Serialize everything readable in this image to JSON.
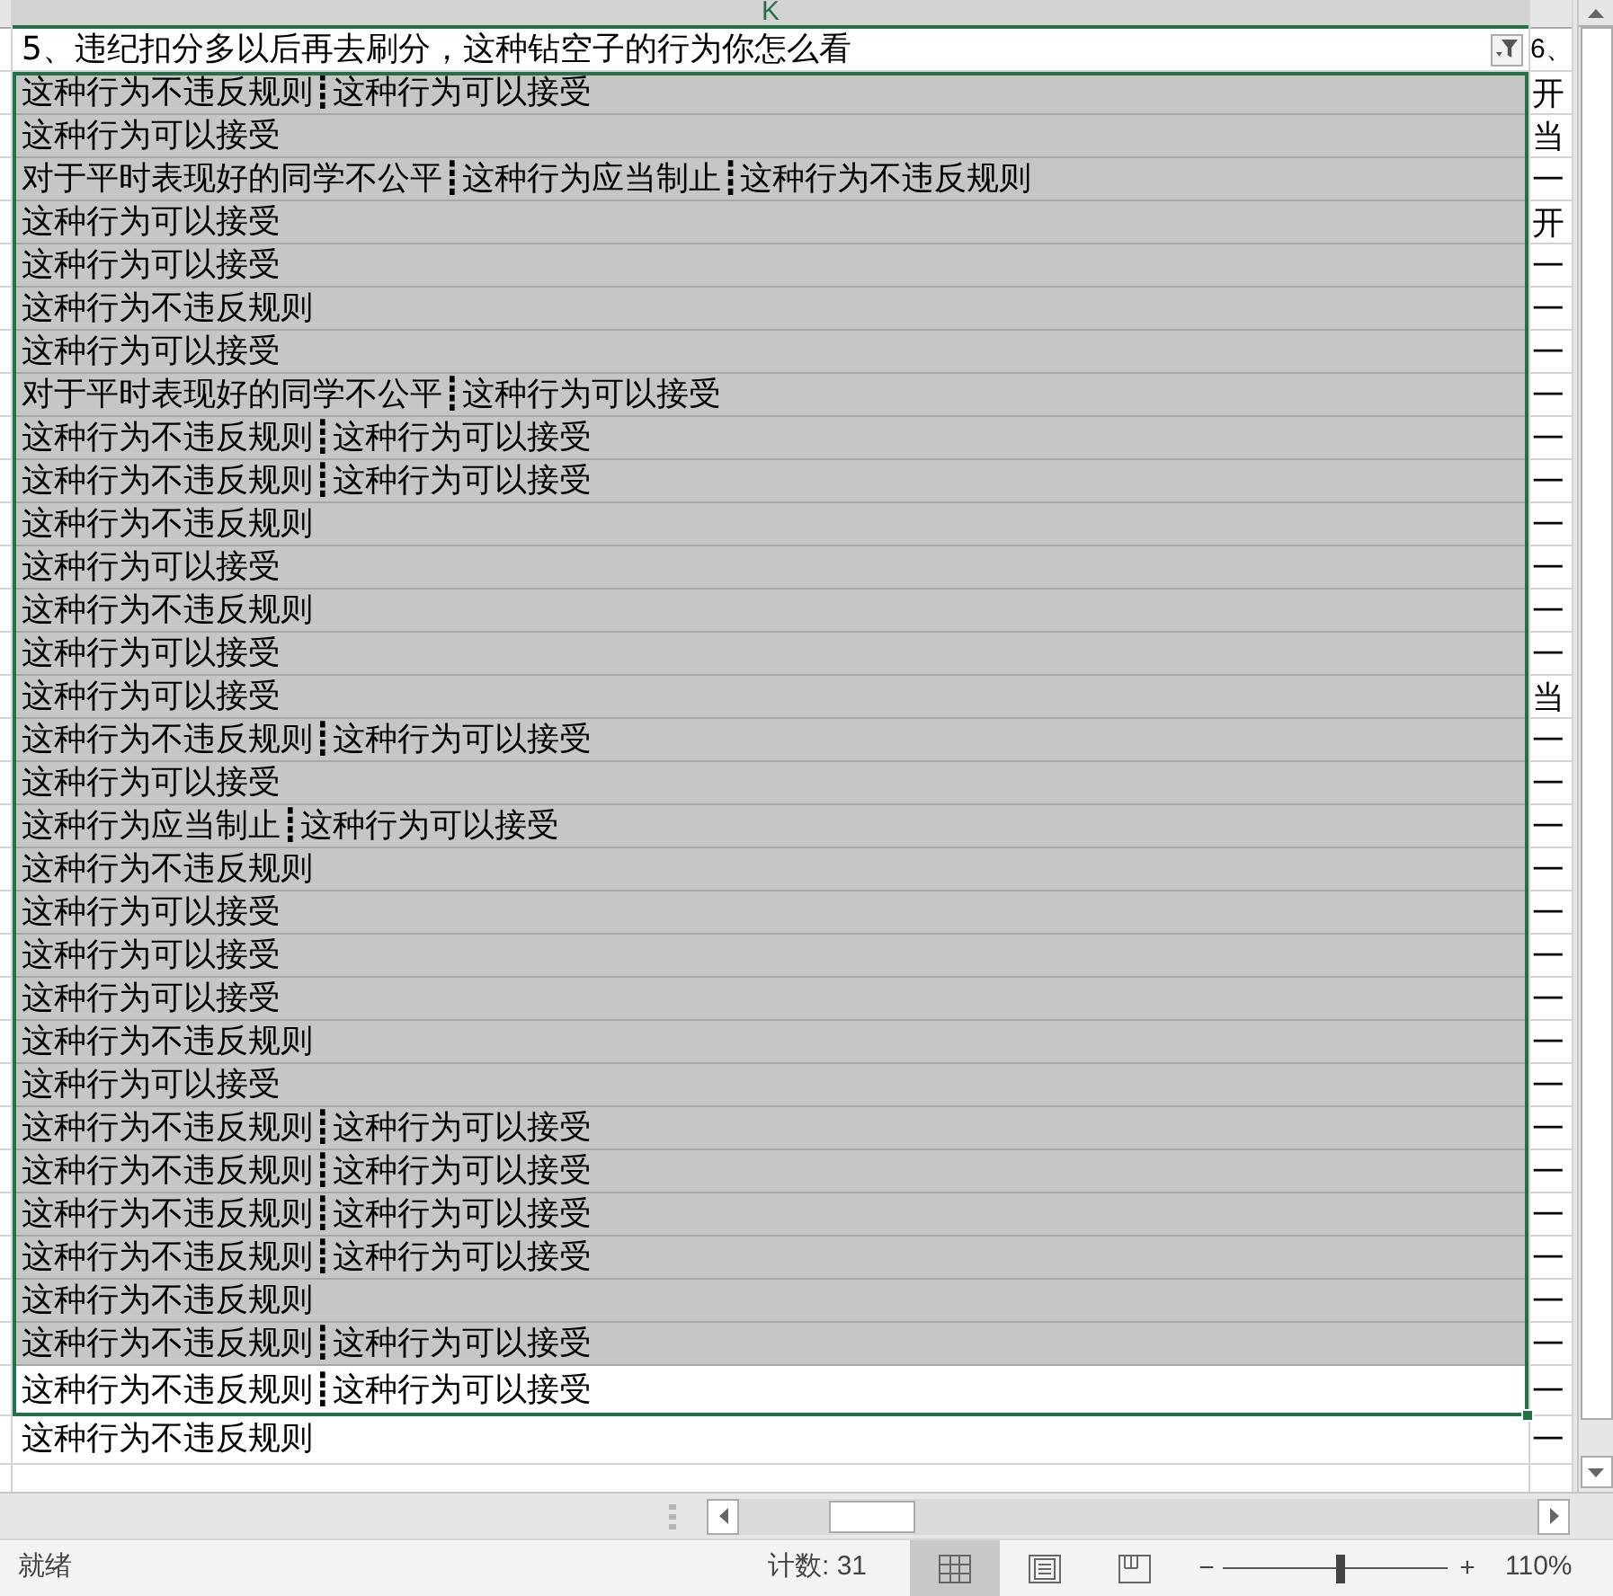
{
  "column_header": {
    "label": "K",
    "selected": true
  },
  "table": {
    "columns": [
      {
        "heading": "5、违纪扣分多以后再去刷分，这种钻空子的行为你怎么看",
        "filter": true
      },
      {
        "heading": "6、"
      }
    ],
    "rows": [
      {
        "cells": [
          "这种行为不违反规则┋这种行为可以接受",
          "开"
        ],
        "selected": true,
        "active": false
      },
      {
        "cells": [
          "这种行为可以接受",
          "当"
        ],
        "selected": true,
        "active": false
      },
      {
        "cells": [
          "对于平时表现好的同学不公平┋这种行为应当制止┋这种行为不违反规则",
          "一"
        ],
        "selected": true,
        "active": false
      },
      {
        "cells": [
          "这种行为可以接受",
          "开"
        ],
        "selected": true,
        "active": false
      },
      {
        "cells": [
          "这种行为可以接受",
          "一"
        ],
        "selected": true,
        "active": false
      },
      {
        "cells": [
          "这种行为不违反规则",
          "一"
        ],
        "selected": true,
        "active": false
      },
      {
        "cells": [
          "这种行为可以接受",
          "一"
        ],
        "selected": true,
        "active": false
      },
      {
        "cells": [
          "对于平时表现好的同学不公平┋这种行为可以接受",
          "一"
        ],
        "selected": true,
        "active": false
      },
      {
        "cells": [
          "这种行为不违反规则┋这种行为可以接受",
          "一"
        ],
        "selected": true,
        "active": false
      },
      {
        "cells": [
          "这种行为不违反规则┋这种行为可以接受",
          "一"
        ],
        "selected": true,
        "active": false
      },
      {
        "cells": [
          "这种行为不违反规则",
          "一"
        ],
        "selected": true,
        "active": false
      },
      {
        "cells": [
          "这种行为可以接受",
          "一"
        ],
        "selected": true,
        "active": false
      },
      {
        "cells": [
          "这种行为不违反规则",
          "一"
        ],
        "selected": true,
        "active": false
      },
      {
        "cells": [
          "这种行为可以接受",
          "一"
        ],
        "selected": true,
        "active": false
      },
      {
        "cells": [
          "这种行为可以接受",
          "当"
        ],
        "selected": true,
        "active": false
      },
      {
        "cells": [
          "这种行为不违反规则┋这种行为可以接受",
          "一"
        ],
        "selected": true,
        "active": false
      },
      {
        "cells": [
          "这种行为可以接受",
          "一"
        ],
        "selected": true,
        "active": false
      },
      {
        "cells": [
          "这种行为应当制止┋这种行为可以接受",
          "一"
        ],
        "selected": true,
        "active": false
      },
      {
        "cells": [
          "这种行为不违反规则",
          "一"
        ],
        "selected": true,
        "active": false
      },
      {
        "cells": [
          "这种行为可以接受",
          "一"
        ],
        "selected": true,
        "active": false
      },
      {
        "cells": [
          "这种行为可以接受",
          "一"
        ],
        "selected": true,
        "active": false
      },
      {
        "cells": [
          "这种行为可以接受",
          "一"
        ],
        "selected": true,
        "active": false
      },
      {
        "cells": [
          "这种行为不违反规则",
          "一"
        ],
        "selected": true,
        "active": false
      },
      {
        "cells": [
          "这种行为可以接受",
          "一"
        ],
        "selected": true,
        "active": false
      },
      {
        "cells": [
          "这种行为不违反规则┋这种行为可以接受",
          "一"
        ],
        "selected": true,
        "active": false
      },
      {
        "cells": [
          "这种行为不违反规则┋这种行为可以接受",
          "一"
        ],
        "selected": true,
        "active": false
      },
      {
        "cells": [
          "这种行为不违反规则┋这种行为可以接受",
          "一"
        ],
        "selected": true,
        "active": false
      },
      {
        "cells": [
          "这种行为不违反规则┋这种行为可以接受",
          "一"
        ],
        "selected": true,
        "active": false
      },
      {
        "cells": [
          "这种行为不违反规则",
          "一"
        ],
        "selected": true,
        "active": false
      },
      {
        "cells": [
          "这种行为不违反规则┋这种行为可以接受",
          "一"
        ],
        "selected": true,
        "active": false
      },
      {
        "cells": [
          "这种行为不违反规则┋这种行为可以接受",
          "一"
        ],
        "selected": true,
        "active": true
      },
      {
        "cells": [
          "这种行为不违反规则",
          "一"
        ],
        "selected": false,
        "active": false
      }
    ]
  },
  "status_bar": {
    "status": "就绪",
    "count": "计数: 31",
    "views": [
      {
        "kind": "normal",
        "selected": true
      },
      {
        "kind": "page_layout",
        "selected": false
      },
      {
        "kind": "page_break",
        "selected": false
      }
    ],
    "zoom_out": "−",
    "zoom_in": "+",
    "zoom": {
      "level": 0.52,
      "reading": "110%"
    }
  }
}
